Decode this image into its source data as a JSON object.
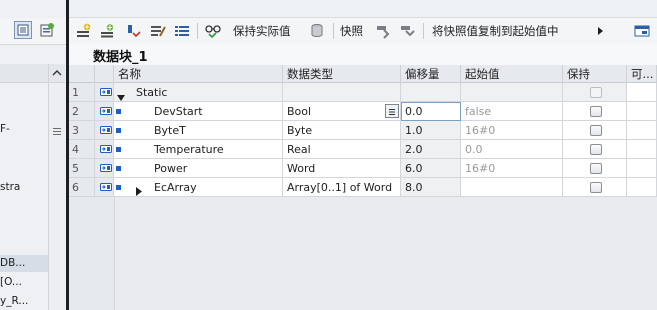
{
  "toolbar": {
    "keep_actual_label": "保持实际值",
    "snapshot_label": "快照",
    "copy_snapshot_label": "将快照值复制到起始值中"
  },
  "block": {
    "title": "数据块_1"
  },
  "columns": {
    "name": "名称",
    "datatype": "数据类型",
    "offset": "偏移量",
    "start": "起始值",
    "retain": "保持",
    "accessible": "可..."
  },
  "rows": [
    {
      "num": "1",
      "name": "Static",
      "type": "",
      "offset": "",
      "start": "",
      "expanded": true
    },
    {
      "num": "2",
      "name": "DevStart",
      "type": "Bool",
      "offset": "0.0",
      "start": "false"
    },
    {
      "num": "3",
      "name": "ByteT",
      "type": "Byte",
      "offset": "1.0",
      "start": "16#0"
    },
    {
      "num": "4",
      "name": "Temperature",
      "type": "Real",
      "offset": "2.0",
      "start": "0.0"
    },
    {
      "num": "5",
      "name": "Power",
      "type": "Word",
      "offset": "6.0",
      "start": "16#0"
    },
    {
      "num": "6",
      "name": "EcArray",
      "type": "Array[0..1] of Word",
      "offset": "8.0",
      "start": "",
      "expanded": false
    }
  ],
  "left_tree": {
    "frag1": "F-",
    "frag2": "stra",
    "frag3": "DB...",
    "frag4": "[O...",
    "frag5": "y_R..."
  },
  "colors": {
    "accent_blue": "#1f5fc4",
    "selected_row": "#d6dde6",
    "splitter": "#1b1f24"
  }
}
